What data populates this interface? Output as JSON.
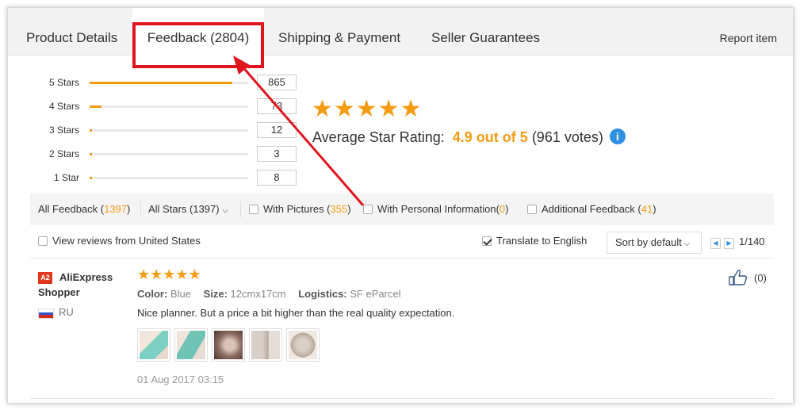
{
  "tabs": [
    {
      "label": "Product Details",
      "active": false
    },
    {
      "label": "Feedback (2804)",
      "active": true
    },
    {
      "label": "Shipping & Payment",
      "active": false
    },
    {
      "label": "Seller Guarantees",
      "active": false
    }
  ],
  "report_item": "Report item",
  "histogram": [
    {
      "label": "5 Stars",
      "count": "865",
      "fraction": 0.9
    },
    {
      "label": "4 Stars",
      "count": "73",
      "fraction": 0.076
    },
    {
      "label": "3 Stars",
      "count": "12",
      "fraction": 0.012
    },
    {
      "label": "2 Stars",
      "count": "3",
      "fraction": 0.003
    },
    {
      "label": "1 Star",
      "count": "8",
      "fraction": 0.008
    }
  ],
  "summary": {
    "stars": "★★★★★",
    "label": "Average Star Rating:",
    "score": "4.9 out of 5",
    "votes": "(961 votes)",
    "info_icon": "i"
  },
  "filters": {
    "all_feedback_label": "All Feedback (",
    "all_feedback_count": "1397",
    "all_stars": "All Stars (1397)",
    "with_pictures_label": "With Pictures (",
    "with_pictures_count": "355",
    "with_personal_label": "With Personal Information(",
    "with_personal_count": "0",
    "additional_label": "Additional Feedback (",
    "additional_count": "41",
    "close_paren": ")"
  },
  "options": {
    "view_us": "View reviews from United States",
    "translate": "Translate to English",
    "translate_checked": true,
    "sort": "Sort by default",
    "page": "1/140"
  },
  "review": {
    "badge": "A2",
    "reviewer": "AliExpress Shopper",
    "country": "RU",
    "stars": "★★★★★",
    "color_label": "Color:",
    "color_value": "Blue",
    "size_label": "Size:",
    "size_value": "12cmx17cm",
    "logistics_label": "Logistics:",
    "logistics_value": "SF eParcel",
    "text": "Nice planner. But a price a bit higher than the real quality expectation.",
    "date": "01 Aug 2017 03:15",
    "helpful_count": "(0)",
    "photo_count": 5
  },
  "colors": {
    "accent": "#f39c12",
    "highlight": "#e0141e",
    "info": "#2f8fe0"
  }
}
